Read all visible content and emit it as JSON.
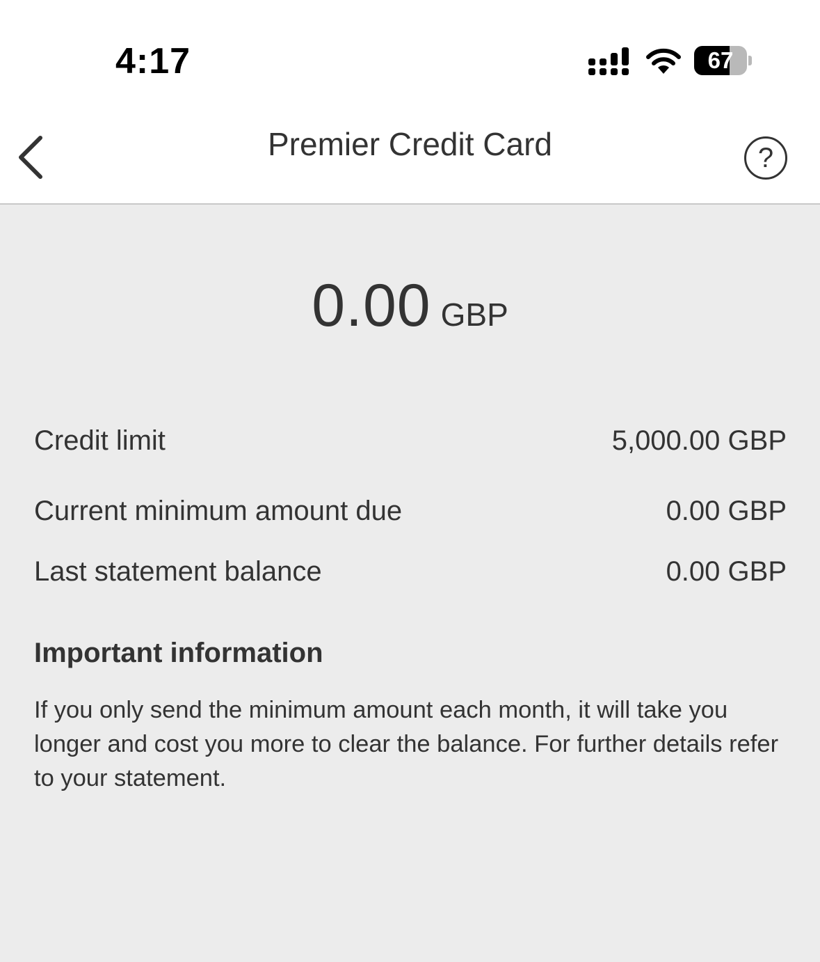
{
  "status_bar": {
    "time": "4:17",
    "battery_level": "67",
    "battery_fraction": 0.67,
    "icons": [
      "signal-icon",
      "wifi-icon",
      "battery-icon"
    ]
  },
  "nav": {
    "title": "Premier Credit Card",
    "back_icon": "chevron-left-icon",
    "help_label": "?"
  },
  "balance": {
    "amount": "0.00",
    "currency": "GBP"
  },
  "details": [
    {
      "label": "Credit limit",
      "value": "5,000.00 GBP"
    },
    {
      "label": "Current minimum amount due",
      "value": "0.00 GBP"
    },
    {
      "label": "Last statement balance",
      "value": "0.00 GBP"
    }
  ],
  "important": {
    "heading": "Important information",
    "text": "If you only send the minimum amount each month, it will take you longer and cost you more to clear the balance. For further details refer to your statement."
  },
  "colors": {
    "background": "#ececec",
    "header": "#ffffff",
    "text": "#333333"
  }
}
